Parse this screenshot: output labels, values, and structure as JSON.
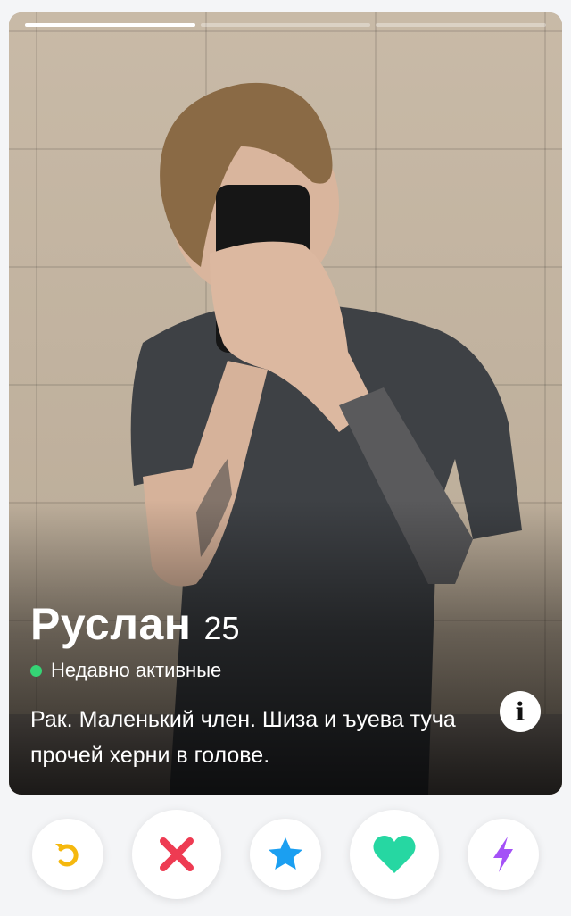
{
  "profile": {
    "name": "Руслан",
    "age": "25",
    "status": "Недавно активные",
    "bio": "Рак. Маленький член. Шиза и ъуева туча прочей херни в голове.",
    "photo_count": 3,
    "current_photo": 1
  },
  "info_button": {
    "label": "i"
  },
  "actions": [
    {
      "name": "rewind-button",
      "icon": "rewind-icon",
      "color": "#f5b80e"
    },
    {
      "name": "nope-button",
      "icon": "x-icon",
      "color": "#ee3b52"
    },
    {
      "name": "super-like-button",
      "icon": "star-icon",
      "color": "#1b9ff1"
    },
    {
      "name": "like-button",
      "icon": "heart-icon",
      "color": "#26d7a2"
    },
    {
      "name": "boost-button",
      "icon": "lightning-icon",
      "color": "#a451f7"
    }
  ],
  "colors": {
    "online": "#35d475",
    "background": "#f4f5f7"
  }
}
